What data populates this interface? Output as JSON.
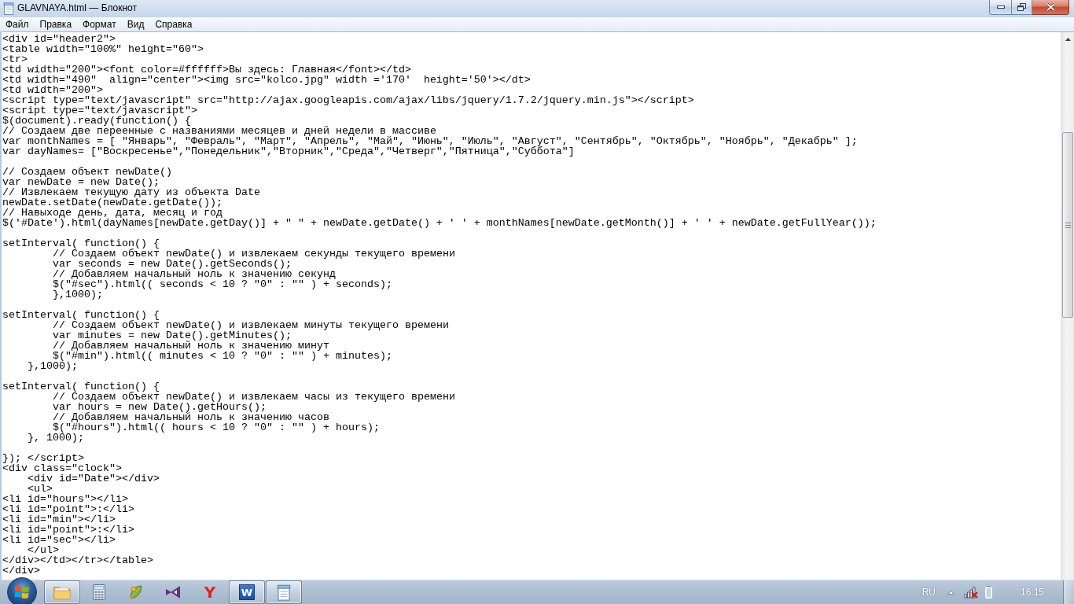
{
  "window": {
    "title": "GLAVNAYA.html — Блокнот"
  },
  "menu": [
    "Файл",
    "Правка",
    "Формат",
    "Вид",
    "Справка"
  ],
  "editor": {
    "blocks": [
      [
        "<div id=\"header2\">",
        "<table width=\"100%\" height=\"60\">",
        "<tr>",
        "<td width=\"200\"><font color=#ffffff>Вы здесь: Главная</font></td>",
        "<td width=\"490\"  align=\"center\"><img src=\"kolco.jpg\" width ='170'  height='50'></dt>",
        "<td width=\"200\">",
        "<script type=\"text/javascript\" src=\"http://ajax.googleapis.com/ajax/libs/jquery/1.7.2/jquery.min.js\"></script>",
        "<script type=\"text/javascript\">",
        "$(document).ready(function() {",
        "// Создаем две переенные с названиями месяцев и дней недели в массиве",
        "var monthNames = [ \"Январь\", \"Февраль\", \"Март\", \"Апрель\", \"Май\", \"Июнь\", \"Июль\", \"Август\", \"Сентябрь\", \"Октябрь\", \"Ноябрь\", \"Декабрь\" ];",
        "var dayNames= [\"Воскресенье\",\"Понедельник\",\"Вторник\",\"Среда\",\"Четверг\",\"Пятница\",\"Суббота\"]"
      ],
      [
        "// Создаем объект newDate()",
        "var newDate = new Date();",
        "// Извлекаем текущую дату из объекта Date",
        "newDate.setDate(newDate.getDate());",
        "// Навыходе день, дата, месяц и год",
        "$('#Date').html(dayNames[newDate.getDay()] + \" \" + newDate.getDate() + ' ' + monthNames[newDate.getMonth()] + ' ' + newDate.getFullYear());"
      ],
      [
        "setInterval( function() {",
        "        // Создаем объект newDate() и извлекаем секунды текущего времени",
        "        var seconds = new Date().getSeconds();",
        "        // Добавляем начальный ноль к значению секунд",
        "        $(\"#sec\").html(( seconds < 10 ? \"0\" : \"\" ) + seconds);",
        "        },1000);"
      ],
      [
        "setInterval( function() {",
        "        // Создаем объект newDate() и извлекаем минуты текущего времени",
        "        var minutes = new Date().getMinutes();",
        "        // Добавляем начальный ноль к значению минут",
        "        $(\"#min\").html(( minutes < 10 ? \"0\" : \"\" ) + minutes);",
        "    },1000);"
      ],
      [
        "setInterval( function() {",
        "        // Создаем объект newDate() и извлекаем часы из текущего времени",
        "        var hours = new Date().getHours();",
        "        // Добавляем начальный ноль к значению часов",
        "        $(\"#hours\").html(( hours < 10 ? \"0\" : \"\" ) + hours);",
        "    }, 1000);"
      ],
      [
        "}); </script>",
        "<div class=\"clock\">",
        "    <div id=\"Date\"></div>",
        "    <ul>",
        "<li id=\"hours\"></li>",
        "<li id=\"point\">:</li>",
        "<li id=\"min\"></li>",
        "<li id=\"point\">:</li>",
        "<li id=\"sec\"></li>",
        "    </ul>",
        "</div></td></tr></table>",
        "</div>"
      ]
    ]
  },
  "taskbar": {
    "apps": [
      {
        "kind": "folder",
        "running": true
      },
      {
        "kind": "calculator",
        "running": false
      },
      {
        "kind": "leaf",
        "running": false
      },
      {
        "kind": "bowtie",
        "running": false
      },
      {
        "kind": "letter",
        "label": "Y",
        "running": false
      },
      {
        "kind": "tile",
        "label": "W",
        "running": true
      },
      {
        "kind": "notepad",
        "running": true
      }
    ],
    "language": "RU",
    "network": {
      "connected": false
    },
    "clock": "16:15"
  }
}
